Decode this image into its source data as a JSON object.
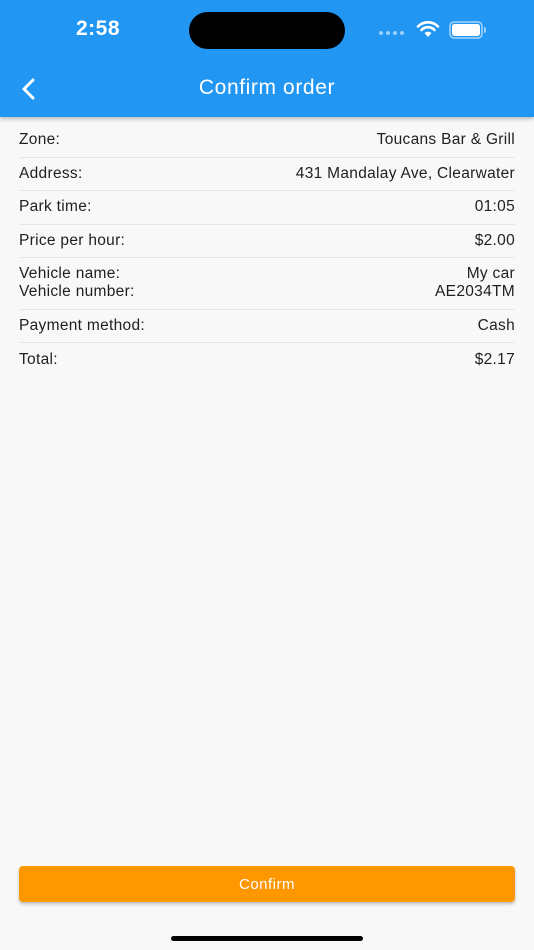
{
  "status_bar": {
    "time": "2:58"
  },
  "app_bar": {
    "title": "Confirm order",
    "background_color": "#2196f3",
    "back_icon": "chevron-left-icon"
  },
  "order": {
    "zone_label": "Zone:",
    "zone_value": "Toucans Bar & Grill",
    "address_label": "Address:",
    "address_value": "431 Mandalay Ave, Clearwater",
    "park_time_label": "Park time:",
    "park_time_value": "01:05",
    "price_label": "Price per hour:",
    "price_value": "$2.00",
    "vehicle_name_label": "Vehicle name:",
    "vehicle_name_value": "My car",
    "vehicle_number_label": "Vehicle number:",
    "vehicle_number_value": "AE2034TM",
    "payment_label": "Payment method:",
    "payment_value": "Cash",
    "total_label": "Total:",
    "total_value": "$2.17"
  },
  "confirm_button": {
    "label": "Confirm",
    "color": "#ff9800"
  }
}
